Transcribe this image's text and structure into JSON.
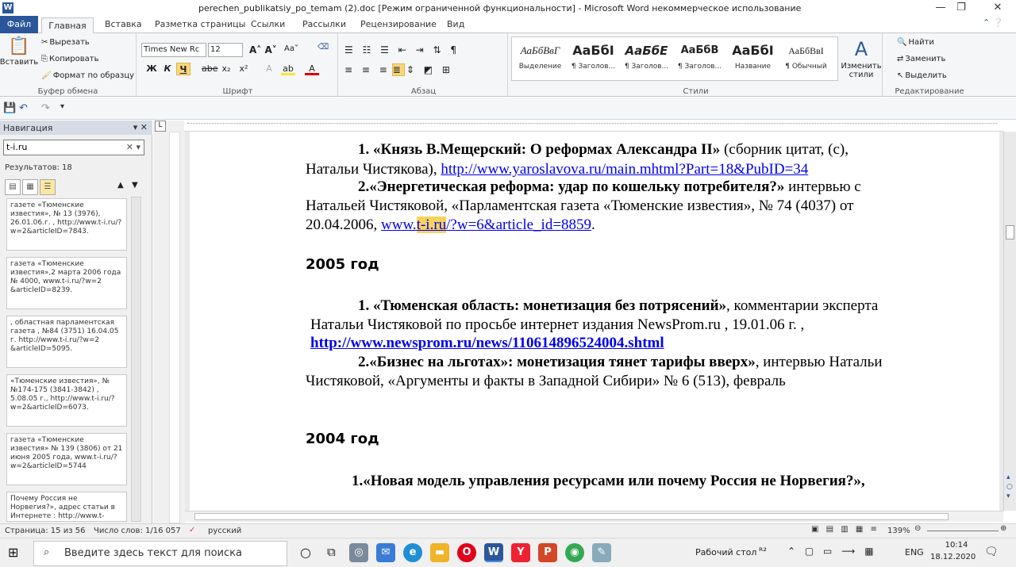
{
  "window": {
    "title": "perechen_publikatsiy_po_temam (2).doc [Режим ограниченной функциональности] - Microsoft Word некоммерческое использование",
    "app_icon": "W"
  },
  "tabs": [
    "Файл",
    "Главная",
    "Вставка",
    "Разметка страницы",
    "Ссылки",
    "Рассылки",
    "Рецензирование",
    "Вид"
  ],
  "clipboard": {
    "paste": "Вставить",
    "cut": "Вырезать",
    "copy": "Копировать",
    "format_painter": "Формат по образцу",
    "label": "Буфер обмена"
  },
  "font": {
    "name": "Times New Rc",
    "size": "12",
    "label": "Шрифт"
  },
  "paragraph": {
    "label": "Абзац"
  },
  "styles": {
    "label": "Стили",
    "items": [
      {
        "sample": "АаБбВвГ",
        "name": "Выделение"
      },
      {
        "sample": "АаБбІ",
        "name": "¶ Заголов..."
      },
      {
        "sample": "АаБбЕ",
        "name": "¶ Заголов..."
      },
      {
        "sample": "АаБбВ",
        "name": "¶ Заголов..."
      },
      {
        "sample": "АаБбІ",
        "name": "Название"
      },
      {
        "sample": "АаБбВвІ",
        "name": "¶ Обычный"
      }
    ],
    "change_label": "Изменить стили"
  },
  "editing": {
    "find": "Найти",
    "replace": "Заменить",
    "select": "Выделить",
    "label": "Редактирование"
  },
  "nav": {
    "title": "Навигация",
    "search_value": "t-i.ru",
    "results": "Результатов: 18",
    "cards": [
      "газете «Тюменские известия», № 13 (3976), 26.01.06.г. , http://www.t-i.ru/?w=2&articleID=7843.",
      "газета «Тюменские известия»,2 марта 2006 года № 4000, www.t-i.ru/?w=2 &articleID=8239.",
      ", областная парламентская газета , №84 (3751) 16.04.05 г. http://www.t-i.ru/?w=2 &articleID=5095.",
      "«Тюменские известия», № №174-175 (3841-3842) , 5.08.05 г., http://www.t-i.ru/?w=2&articleID=6073.",
      "газета «Тюменские известия» № 139 (3806) от 21 июня 2005 года, www.t-i.ru/?w=2&articleID=5744",
      "Почему Россия не Норвегия?», адрес статьи в Интернете : http://www.t-"
    ]
  },
  "doc": {
    "p1a": "1. «Князь В.Мещерский: О реформах Александра II»",
    "p1b": " (сборник   цитат, (с),",
    "p1c": "Натальи Чистякова), ",
    "p1link": "http://www.yaroslavova.ru/main.mhtml?Part=18&PubID=34",
    "p2a": "2.«Энергетическая реформа: удар по кошельку потребителя?»",
    "p2b": " интервью с",
    "p2c": "Натальей Чистяковой, «Парламентская газета «Тюменские известия», № 74 (4037) от",
    "p2d": "20.04.2006, ",
    "p2link_a": "www.",
    "p2link_hl": "t-i.ru",
    "p2link_b": "/?w=6&article_id=8859",
    "p2end": ".",
    "h2005": "2005 год",
    "p3a": "1. «Тюменская область: монетизация без потрясений»",
    "p3b": ", комментарии эксперта",
    "p3c": "Натальи  Чистяковой по просьбе интернет издания NewsProm.ru ,     19.01.06 г. ,",
    "p3link": "http://www.newsprom.ru/news/110614896524004.shtml",
    "p4a": "2.«Бизнес на льготах»:  монетизация тянет тарифы вверх»",
    "p4b": ", интервью Натальи",
    "p4c": "Чистяковой, «Аргументы и факты в Западной Сибири» № 6 (513), февраль",
    "h2004": "2004 год",
    "p5": "1.«Новая модель управления ресурсами или почему  Россия не Норвегия?»,"
  },
  "status": {
    "page": "Страница: 15 из 56",
    "words": "Число слов: 1/16 057",
    "lang": "русский",
    "zoom": "139%"
  },
  "taskbar": {
    "search_placeholder": "Введите здесь текст для поиска",
    "desktop": "Рабочий стол",
    "lang": "ENG",
    "time": "10:14",
    "date": "18.12.2020"
  },
  "colors": {
    "accent": "#2b579a",
    "link": "#0000ee",
    "highlight": "#f6d35c"
  }
}
